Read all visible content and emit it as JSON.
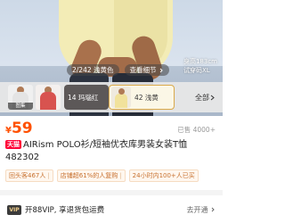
{
  "gallery": {
    "counter": "2/242 浅黄色",
    "view_label": "查看细节",
    "model_height": "身高183cm",
    "model_size": "试穿码XL"
  },
  "color_strip": {
    "thumb1_badge": "图集",
    "option_red": "14 玛瑙红",
    "option_yellow": "42 浅黄",
    "all_label": "全部"
  },
  "product": {
    "currency": "¥",
    "price": "59",
    "sold": "已售 4000+",
    "store_tag": "天猫",
    "title": "AIRism POLO衫/短袖优衣库男装女装T恤482302"
  },
  "chips": [
    "回头客467人",
    "店铺超61%的人复购",
    "24小时内100+人已买"
  ],
  "vip_banner": {
    "logo": "VIP",
    "text": "开88VIP, 享退货包运费",
    "action": "去开通"
  },
  "colors": {
    "price": "#ff5000",
    "tmall": "#ff0036",
    "chip_text": "#c7712f",
    "selected_border": "#d9a94b"
  }
}
